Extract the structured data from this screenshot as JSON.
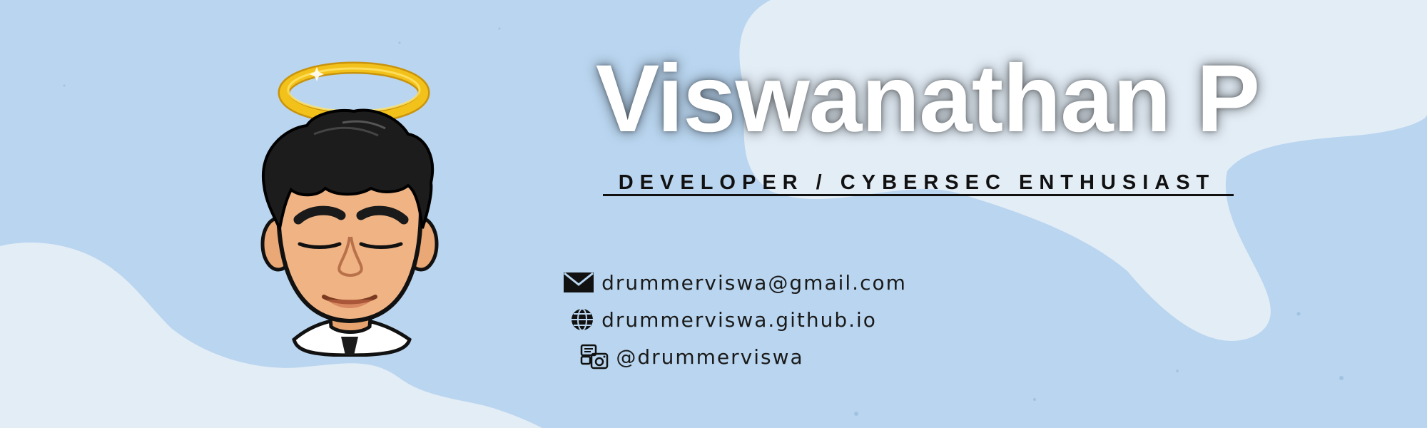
{
  "banner": {
    "name": "Viswanathan P",
    "subtitle": "DEVELOPER / CYBERSEC ENTHUSIAST",
    "contacts": [
      {
        "icon": "envelope-icon",
        "text": "drummerviswa@gmail.com"
      },
      {
        "icon": "globe-icon",
        "text": "drummerviswa.github.io"
      },
      {
        "icon": "social-media-icon",
        "text": "@drummerviswa"
      }
    ],
    "avatar": "cartoon-avatar-with-halo",
    "colors": {
      "background": "#b9d5ef",
      "cloud": "#e3edf6",
      "name_text": "#ffffff",
      "text": "#111111",
      "halo": "#f2c21b"
    }
  }
}
